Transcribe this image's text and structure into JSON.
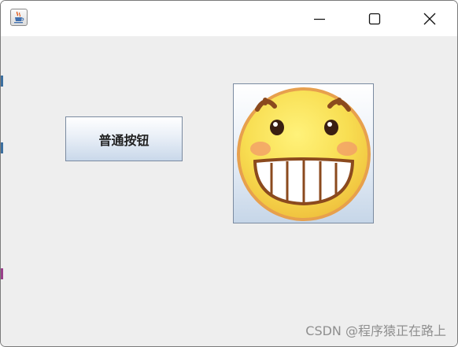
{
  "window": {
    "title": "",
    "icon": "java-coffee-icon",
    "controls": {
      "minimize_icon": "minimize-icon",
      "maximize_icon": "maximize-icon",
      "close_icon": "close-icon"
    }
  },
  "main": {
    "normal_button_label": "普通按钮",
    "image_button_icon": "grinning-face-icon"
  },
  "watermark": "CSDN @程序猿正在路上",
  "colors": {
    "content_background": "#eeeeee",
    "titlebar_background": "#ffffff",
    "face_yellow": "#f9e05a",
    "face_outline": "#e7a04d",
    "eyebrow_brown": "#8b4a1e"
  }
}
